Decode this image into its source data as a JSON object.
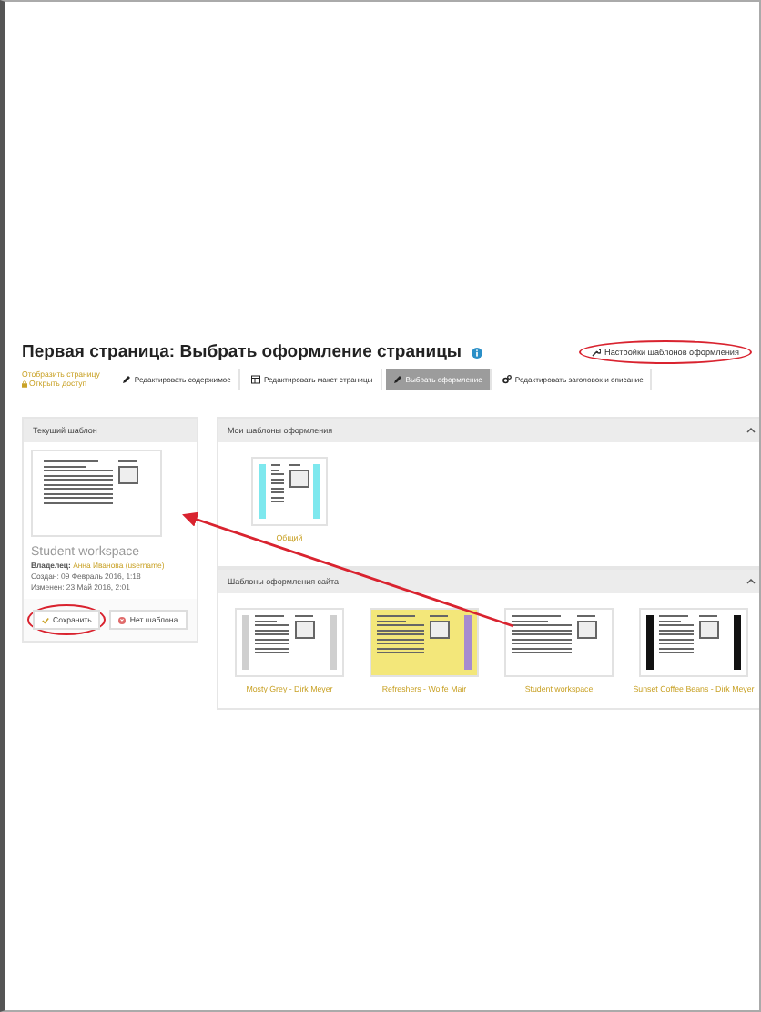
{
  "page": {
    "title": "Первая страница: Выбрать оформление страницы",
    "settings_link": "Настройки шаблонов оформления"
  },
  "side_links": [
    "Отобразить страницу",
    "Открыть доступ"
  ],
  "tabs": [
    {
      "label": "Редактировать содержимое",
      "selected": false,
      "kind": "pencil"
    },
    {
      "label": "Редактировать макет страницы",
      "selected": false,
      "kind": "layout"
    },
    {
      "label": "Выбрать оформление",
      "selected": true,
      "kind": "pencil"
    },
    {
      "label": "Редактировать заголовок и описание",
      "selected": false,
      "kind": "gears"
    }
  ],
  "current": {
    "heading": "Текущий шаблон",
    "name": "Student workspace",
    "owner_label": "Владелец:",
    "owner": "Анна Иванова (username)",
    "created": "Создан: 09 Февраль 2016, 1:18",
    "modified": "Изменен: 23 Май 2016, 2:01",
    "buttons": [
      {
        "label": "Сохранить",
        "kind": "save"
      },
      {
        "label": "Нет шаблона",
        "kind": "none"
      }
    ]
  },
  "my_templates": {
    "heading": "Мои шаблоны оформления",
    "expanded": true,
    "items": [
      {
        "name": "Общий",
        "kind": "cyan"
      }
    ]
  },
  "site_templates": {
    "heading": "Шаблоны оформления сайта",
    "expanded": true,
    "items": [
      {
        "name": "Mosty Grey - Dirk Meyer",
        "kind": "grey"
      },
      {
        "name": "Refreshers - Wolfe Mair",
        "kind": "yellow"
      },
      {
        "name": "Student workspace",
        "kind": "plain"
      },
      {
        "name": "Sunset Coffee Beans - Dirk Meyer",
        "kind": "dark"
      }
    ]
  }
}
